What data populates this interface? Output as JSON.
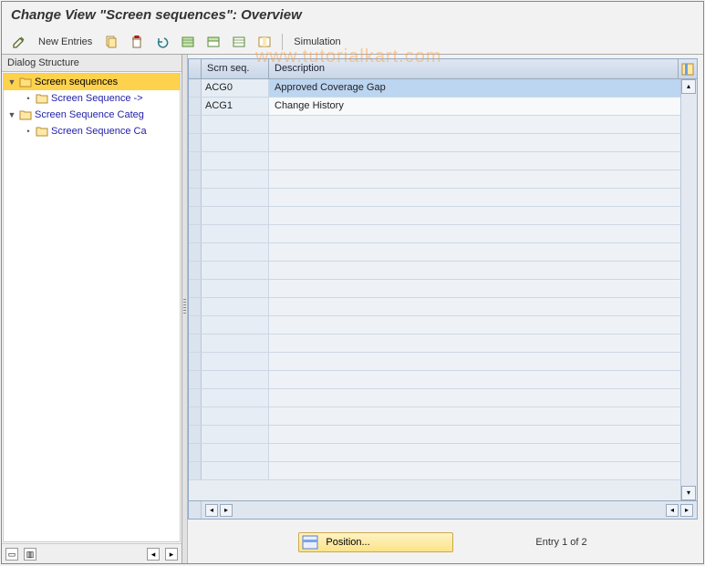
{
  "title": "Change View \"Screen sequences\": Overview",
  "watermark": "www.tutorialkart.com",
  "toolbar": {
    "new_entries": "New Entries",
    "simulation": "Simulation"
  },
  "sidebar": {
    "title": "Dialog Structure",
    "nodes": [
      {
        "label": "Screen sequences",
        "expanded": true,
        "selected": true
      },
      {
        "label": "Screen Sequence ->",
        "child": true
      },
      {
        "label": "Screen Sequence Categ",
        "expanded": true
      },
      {
        "label": "Screen Sequence Ca",
        "child": true
      }
    ]
  },
  "grid": {
    "col1_header": "Scrn seq.",
    "col2_header": "Description",
    "rows": [
      {
        "seq": "ACG0",
        "desc": "Approved Coverage Gap",
        "selected": true
      },
      {
        "seq": "ACG1",
        "desc": "Change History",
        "selected": false
      }
    ],
    "empty_row_count": 20
  },
  "footer": {
    "position_label": "Position...",
    "entry_text": "Entry 1 of 2"
  }
}
